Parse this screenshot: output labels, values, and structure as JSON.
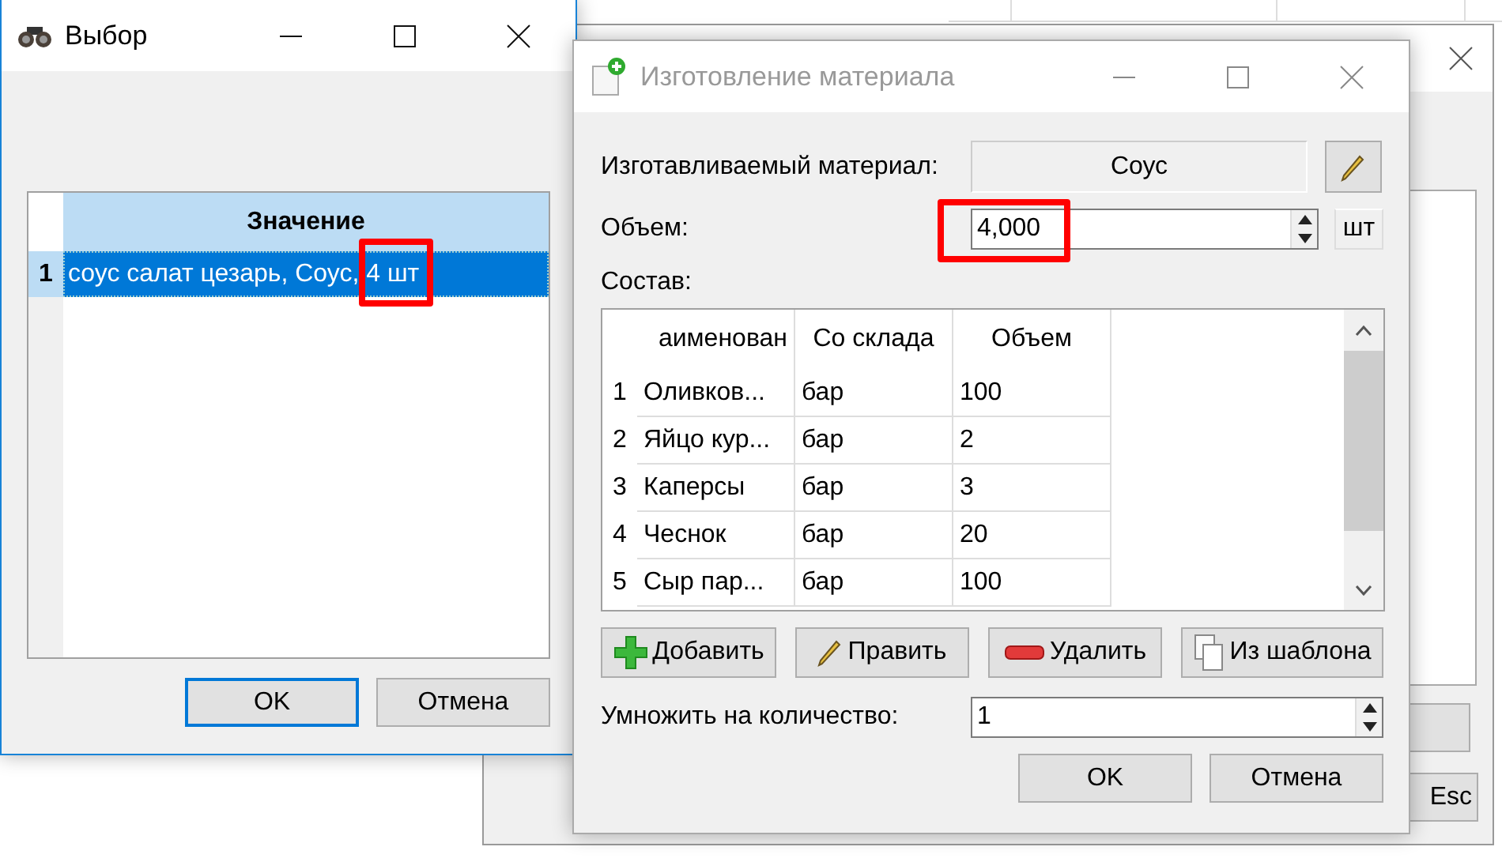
{
  "background_window": {
    "button_label": "Esc"
  },
  "selection_dialog": {
    "title": "Выбор",
    "active": true,
    "table": {
      "columns": [
        "Значение"
      ],
      "rows": [
        {
          "number": "1",
          "value": "соус салат цезарь, Соус, 4 шт",
          "selected": true,
          "highlighted": true
        }
      ]
    },
    "buttons": [
      {
        "label": "OK",
        "focused": true
      },
      {
        "label": "Отмена",
        "focused": false
      }
    ]
  },
  "material_dialog": {
    "title": "Изготовление материала",
    "active": false,
    "material_label": "Изготавливаемый материал:",
    "material_value": "Соус",
    "volume_label": "Объем:",
    "volume_value": "4,000",
    "volume_highlighted": true,
    "volume_unit": "шт",
    "composition_label": "Состав:",
    "table": {
      "columns": [
        "аименован",
        "Со склада",
        "Объем"
      ],
      "rows": [
        {
          "number": "1",
          "cells": [
            "Оливков...",
            "бар",
            "100"
          ]
        },
        {
          "number": "2",
          "cells": [
            "Яйцо кур...",
            "бар",
            "2"
          ]
        },
        {
          "number": "3",
          "cells": [
            "Каперсы",
            "бар",
            "3"
          ]
        },
        {
          "number": "4",
          "cells": [
            "Чеснок",
            "бар",
            "20"
          ]
        },
        {
          "number": "5",
          "cells": [
            "Сыр пар...",
            "бар",
            "100"
          ]
        }
      ]
    },
    "actions": [
      {
        "kind": "add",
        "label": "Добавить"
      },
      {
        "kind": "edit",
        "label": "Править"
      },
      {
        "kind": "delete",
        "label": "Удалить"
      },
      {
        "kind": "template",
        "label": "Из шаблона"
      }
    ],
    "multiply_label": "Умножить на количество:",
    "multiply_value": "1",
    "buttons": [
      {
        "label": "OK"
      },
      {
        "label": "Отмена"
      }
    ]
  }
}
